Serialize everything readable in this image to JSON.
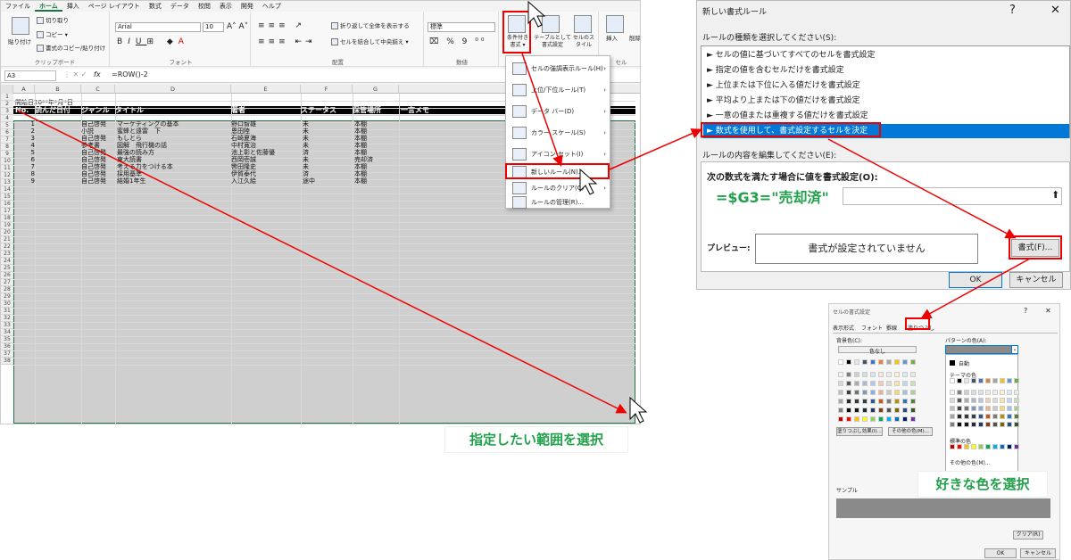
{
  "menubar": [
    "ファイル",
    "ホーム",
    "挿入",
    "ページ レイアウト",
    "数式",
    "データ",
    "校閲",
    "表示",
    "開発",
    "ヘルプ"
  ],
  "ribbon": {
    "paste": "貼り付け",
    "cut": "切り取り",
    "copy": "コピー ▾",
    "format_painter": "書式のコピー/貼り付け",
    "clipboard": "クリップボード",
    "font_name": "Arial",
    "font_size": "10",
    "font": "フォント",
    "wrap": "折り返して全体を表示する",
    "merge": "セルを結合して中央揃え ▾",
    "alignment": "配置",
    "number_format": "標準",
    "number": "数値",
    "cond_format": "条件付き書式 ▾",
    "format_table": "テーブルとして書式設定",
    "cell_style": "セルのスタイル",
    "insert": "挿入",
    "delete": "削除",
    "cells": "セル"
  },
  "formula_bar": {
    "name_box": "A3",
    "fx": "fx",
    "formula": "=ROW()-2"
  },
  "columns": [
    "A",
    "B",
    "C",
    "D",
    "E",
    "F",
    "G"
  ],
  "rows": [
    "1",
    "2",
    "3",
    "4",
    "5",
    "6",
    "7",
    "8",
    "9",
    "10",
    "11",
    "12",
    "13",
    "14",
    "15",
    "16",
    "17",
    "18",
    "19",
    "20",
    "21",
    "22",
    "23",
    "24",
    "25",
    "26",
    "27",
    "28",
    "29",
    "30",
    "31",
    "32",
    "33",
    "34",
    "35",
    "36",
    "37",
    "38"
  ],
  "sheet": {
    "r1": "開始日20**年*月*日",
    "headers": [
      "No.",
      "読んだ日付",
      "ジャンル",
      "タイトル",
      "著者",
      "ステータス",
      "保管場所",
      "一言メモ"
    ],
    "data": [
      [
        "1",
        "",
        "自己啓発",
        "マーケティングの基本",
        "野口智雄",
        "未",
        "本棚"
      ],
      [
        "2",
        "",
        "小説",
        "蜜蜂と遠雷　下",
        "恩田陸",
        "未",
        "本棚"
      ],
      [
        "3",
        "",
        "自己啓発",
        "もしとら",
        "石崎夏海",
        "未",
        "本棚"
      ],
      [
        "4",
        "",
        "参考書",
        "図解　飛行機の話",
        "中村寛治",
        "未",
        "本棚"
      ],
      [
        "5",
        "",
        "自己啓発",
        "最強の読み方",
        "池上彰と佐藤優",
        "済",
        "本棚"
      ],
      [
        "6",
        "",
        "自己啓発",
        "東大読書",
        "西岡壱誠",
        "未",
        "売却済"
      ],
      [
        "7",
        "",
        "自己啓発",
        "考える力をつける本",
        "轡田隆史",
        "未",
        "本棚"
      ],
      [
        "8",
        "",
        "自己啓発",
        "採用基準",
        "伊賀泰代",
        "済",
        "本棚"
      ],
      [
        "9",
        "",
        "自己啓発",
        "結婚1年生",
        "入江久絵",
        "途中",
        "本棚"
      ]
    ]
  },
  "dropdown": [
    {
      "label": "セルの強調表示ルール(H)",
      "arrow": "›"
    },
    {
      "label": "上位/下位ルール(T)",
      "arrow": "›"
    },
    {
      "label": "データ バー(D)",
      "arrow": "›"
    },
    {
      "label": "カラー スケール(S)",
      "arrow": "›"
    },
    {
      "label": "アイコン セット(I)",
      "arrow": "›"
    },
    {
      "label": "新しいルール(N)...",
      "arrow": ""
    },
    {
      "label": "ルールのクリア(C)",
      "arrow": "›"
    },
    {
      "label": "ルールの管理(R)...",
      "arrow": ""
    }
  ],
  "dialog1": {
    "title": "新しい書式ルール",
    "help": "?",
    "close": "✕",
    "select_type": "ルールの種類を選択してください(S):",
    "rule_types": [
      "► セルの値に基づいてすべてのセルを書式設定",
      "► 指定の値を含むセルだけを書式設定",
      "► 上位または下位に入る値だけを書式設定",
      "► 平均より上または下の値だけを書式設定",
      "► 一意の値または重複する値だけを書式設定",
      "► 数式を使用して、書式設定するセルを決定"
    ],
    "edit_label": "ルールの内容を編集してください(E):",
    "formula_label": "次の数式を満たす場合に値を書式設定(O):",
    "formula": "=$G3=\"売却済\"",
    "collapse": "⬆",
    "preview_label": "プレビュー:",
    "preview_text": "書式が設定されていません",
    "format_btn": "書式(F)...",
    "ok": "OK",
    "cancel": "キャンセル"
  },
  "dialog2": {
    "title": "セルの書式設定",
    "help": "?",
    "close": "✕",
    "tabs": [
      "表示形式",
      "フォント",
      "罫線",
      "塗りつぶし"
    ],
    "bg_color": "背景色(C):",
    "no_color": "色なし",
    "pattern_color": "パターンの色(A):",
    "pattern_style": "パターンの種類(P):",
    "auto": "自動",
    "theme_colors": "テーマの色",
    "standard_colors": "標準の色",
    "other_colors": "その他の色(M)...",
    "fill_effects": "塗りつぶし効果(I)...",
    "other_colors2": "その他の色(M)...",
    "sample": "サンプル",
    "clear": "クリア(R)",
    "ok": "OK",
    "cancel": "キャンセル"
  },
  "captions": {
    "range": "指定したい範囲を選択",
    "color": "好きな色を選択"
  },
  "colors": {
    "accent": "#0078d7",
    "annotation": "#e00000",
    "caption": "#22a04b",
    "header_bg": "#000000",
    "selection": "#cfcfcf"
  }
}
